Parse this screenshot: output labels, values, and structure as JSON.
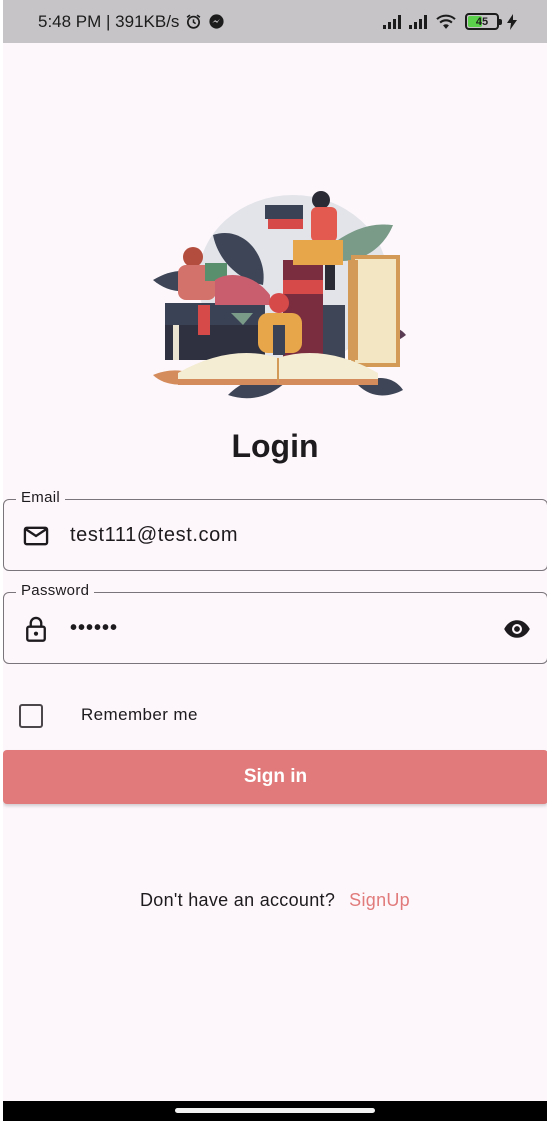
{
  "status_bar": {
    "time_speed": "5:48 PM | 391KB/s",
    "battery_level": "45",
    "icons": [
      "alarm-icon",
      "messenger-icon",
      "signal-icon",
      "signal-icon",
      "wifi-icon",
      "battery-icon",
      "charging-icon"
    ]
  },
  "page": {
    "title": "Login"
  },
  "email": {
    "label": "Email",
    "value": "test111@test.com",
    "icon": "mail-icon"
  },
  "password": {
    "label": "Password",
    "masked_value": "••••••",
    "icon": "lock-icon",
    "toggle_icon": "eye-icon"
  },
  "remember": {
    "label": "Remember me",
    "checked": false
  },
  "actions": {
    "signin_label": "Sign in"
  },
  "signup": {
    "prompt": "Don't have an account?",
    "link_label": "SignUp"
  },
  "colors": {
    "accent": "#e17b7b",
    "background": "#fdf7fb",
    "status_bar": "#c6c4c7"
  }
}
